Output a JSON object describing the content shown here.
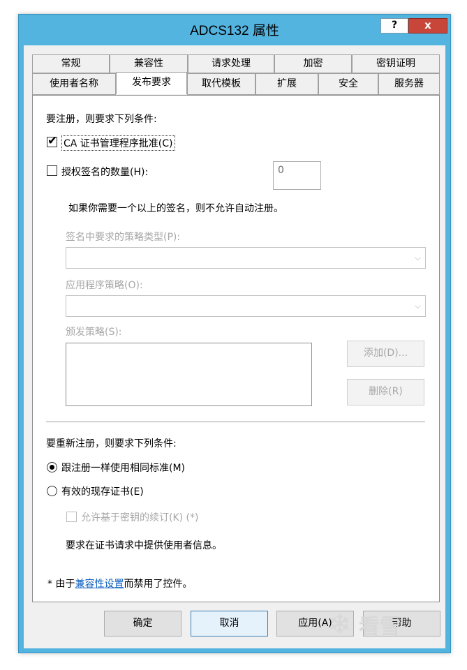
{
  "window": {
    "title": "ADCS132 属性",
    "help_label": "?",
    "close_label": "x"
  },
  "tabs_row1": [
    "常规",
    "兼容性",
    "请求处理",
    "加密",
    "密钥证明"
  ],
  "tabs_row2": [
    "使用者名称",
    "发布要求",
    "取代模板",
    "扩展",
    "安全",
    "服务器"
  ],
  "selected_tab": "发布要求",
  "issuance": {
    "heading": "要注册，则要求下列条件:",
    "ca_manager_label": "CA 证书管理程序批准(C)",
    "ca_manager_checked": true,
    "signatures_label": "授权签名的数量(H):",
    "signatures_checked": false,
    "signatures_value": "0",
    "signatures_note": "如果你需要一个以上的签名，则不允许自动注册。",
    "policy_type_label": "签名中要求的策略类型(P):",
    "app_policy_label": "应用程序策略(O):",
    "issuance_policy_label": "颁发策略(S):",
    "add_label": "添加(D)...",
    "remove_label": "删除(R)"
  },
  "reenroll": {
    "heading": "要重新注册，则要求下列条件:",
    "same_criteria_label": "跟注册一样使用相同标准(M)",
    "same_criteria_selected": true,
    "valid_cert_label": "有效的现存证书(E)",
    "valid_cert_selected": false,
    "key_renewal_label": "允许基于密钥的续订(K) (*)",
    "key_renewal_checked": false,
    "subject_info_note": "要求在证书请求中提供使用者信息。"
  },
  "footnote": {
    "prefix": "* 由于",
    "link_text": "兼容性设置",
    "suffix": "而禁用了控件。"
  },
  "buttons": {
    "ok": "确定",
    "cancel": "取消",
    "apply": "应用(A)",
    "help": "帮助"
  },
  "watermark_text": "看雪"
}
